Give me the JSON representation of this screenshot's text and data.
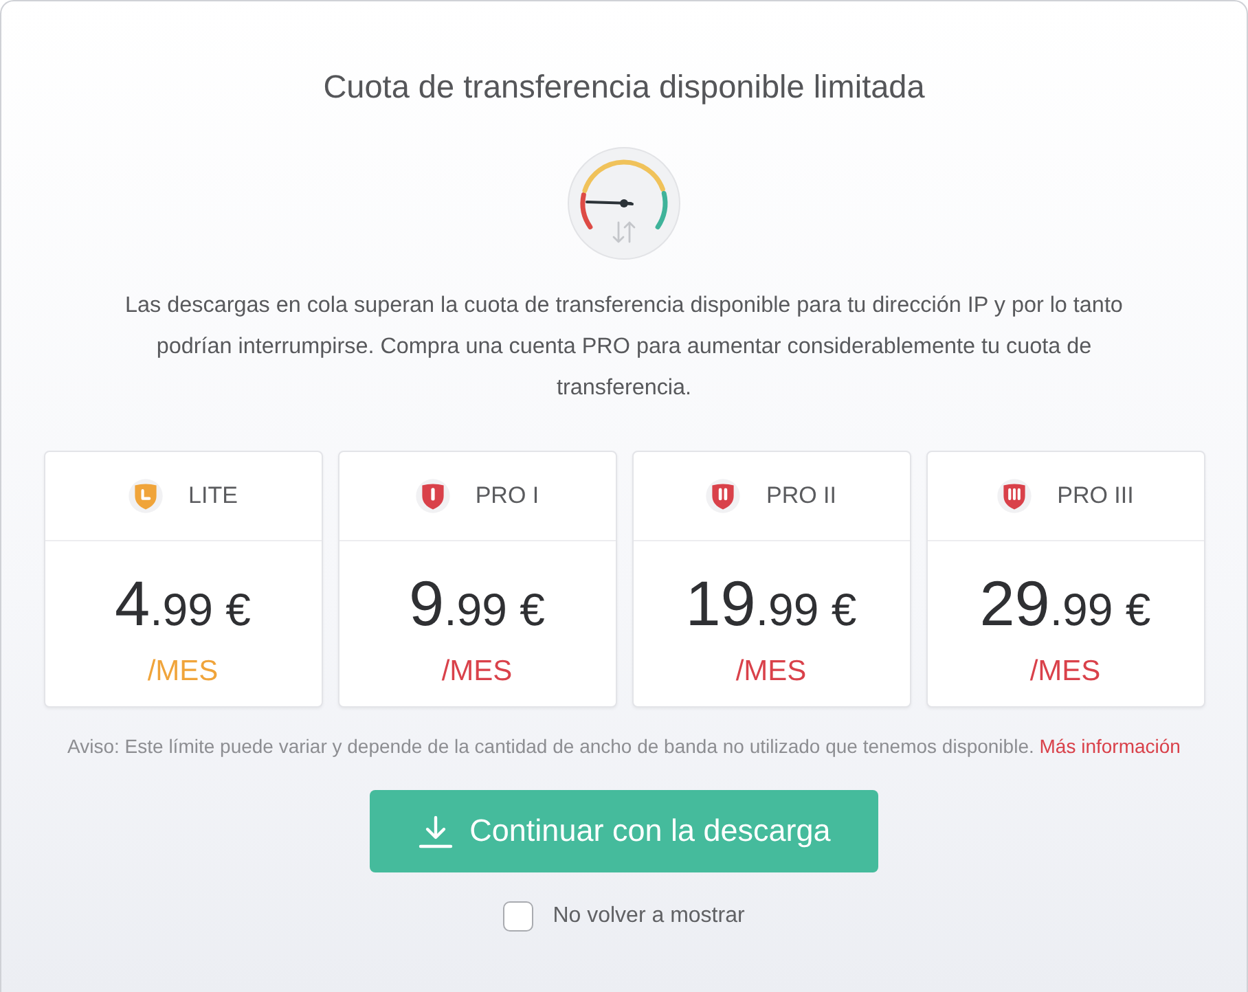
{
  "dialog": {
    "title": "Cuota de transferencia disponible limitada",
    "message": "Las descargas en cola superan la cuota de transferencia disponible para tu dirección IP y por lo tanto podrían interrumpirse. Compra una cuenta PRO para aumentar considerablemente tu cuota de transferencia."
  },
  "plans": [
    {
      "kind": "lite",
      "name": "LITE",
      "price_whole": "4",
      "price_fraction": ".99 €",
      "period": "/MES",
      "color": "#f0a43a"
    },
    {
      "kind": "single",
      "name": "PRO I",
      "price_whole": "9",
      "price_fraction": ".99 €",
      "period": "/MES",
      "color": "#d9414a"
    },
    {
      "kind": "double",
      "name": "PRO II",
      "price_whole": "19",
      "price_fraction": ".99 €",
      "period": "/MES",
      "color": "#d9414a"
    },
    {
      "kind": "triple",
      "name": "PRO III",
      "price_whole": "29",
      "price_fraction": ".99 €",
      "period": "/MES",
      "color": "#d9414a"
    }
  ],
  "notice": {
    "text": "Aviso: Este límite puede variar y depende de la cantidad de ancho de banda no utilizado que tenemos disponible.",
    "link": "Más información"
  },
  "primary_button": {
    "label": "Continuar con la descarga"
  },
  "dont_show_again": {
    "label": "No volver a mostrar",
    "checked": false
  }
}
